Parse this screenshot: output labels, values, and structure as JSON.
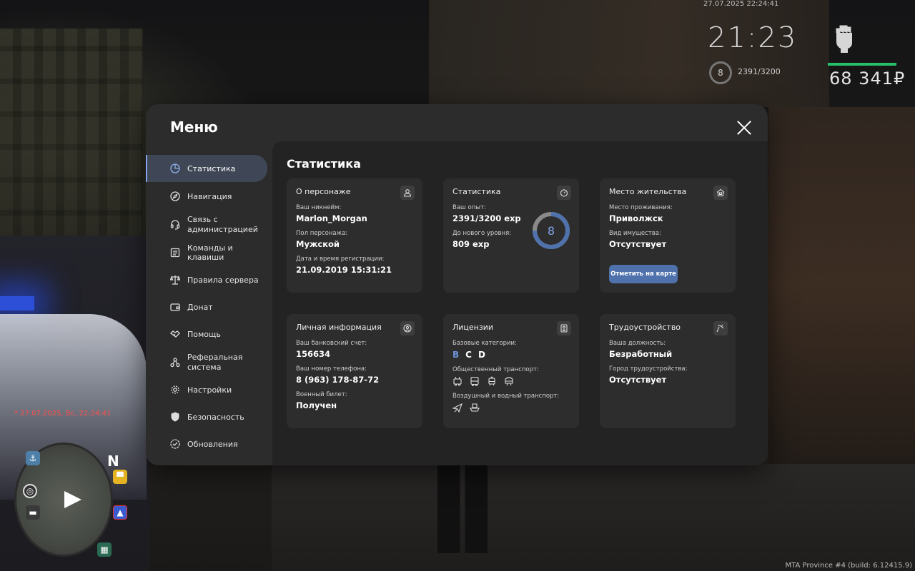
{
  "hud": {
    "datetime": "27.07.2025 22:24:41",
    "clock": "21:23",
    "level": "8",
    "exp": "2391/3200",
    "money": "68 341₽",
    "chat_message": "* 27.07.2025, Вс, 22:24:41",
    "build": "MTA Province #4 (build: 6.12415.9)",
    "minimap_north": "N"
  },
  "menu": {
    "title": "Меню",
    "sidebar": [
      {
        "label": "Статистика",
        "icon": "pie-chart-icon",
        "active": true
      },
      {
        "label": "Навигация",
        "icon": "compass-icon"
      },
      {
        "label": "Связь с администрацией",
        "icon": "headset-icon"
      },
      {
        "label": "Команды и клавиши",
        "icon": "list-icon"
      },
      {
        "label": "Правила сервера",
        "icon": "scales-icon"
      },
      {
        "label": "Донат",
        "icon": "wallet-icon"
      },
      {
        "label": "Помощь",
        "icon": "handshake-icon"
      },
      {
        "label": "Реферальная система",
        "icon": "people-icon"
      },
      {
        "label": "Настройки",
        "icon": "gear-icon"
      },
      {
        "label": "Безопасность",
        "icon": "shield-icon"
      },
      {
        "label": "Обновления",
        "icon": "check-circle-icon"
      }
    ],
    "content_title": "Статистика",
    "cards": {
      "character": {
        "title": "О персонаже",
        "nickname_label": "Ваш никнейм:",
        "nickname": "Marlon_Morgan",
        "gender_label": "Пол персонажа:",
        "gender": "Мужской",
        "reg_label": "Дата и время регистрации:",
        "reg_date": "21.09.2019 15:31:21"
      },
      "stats": {
        "title": "Статистика",
        "exp_label": "Ваш опыт:",
        "exp": "2391/3200 exp",
        "next_label": "До нового уровня:",
        "next": "809 exp",
        "level": "8",
        "progress": 0.747,
        "accent": "#7fa3e6"
      },
      "residence": {
        "title": "Место жительства",
        "place_label": "Место проживания:",
        "place": "Приволжск",
        "property_label": "Вид имущества:",
        "property": "Отсутствует",
        "button": "Отметить на карте"
      },
      "personal": {
        "title": "Личная информация",
        "bank_label": "Ваш банковский счет:",
        "bank": "156634",
        "phone_label": "Ваш номер телефона:",
        "phone": "8 (963) 178-87-72",
        "military_label": "Военный билет:",
        "military": "Получен"
      },
      "licenses": {
        "title": "Лицензии",
        "basic_label": "Базовые категории:",
        "categories": [
          {
            "name": "B",
            "active": true
          },
          {
            "name": "C",
            "active": false
          },
          {
            "name": "D",
            "active": false
          }
        ],
        "public_label": "Общественный транспорт:",
        "air_label": "Воздушный и водный транспорт:"
      },
      "employment": {
        "title": "Трудоустройство",
        "position_label": "Ваша должность:",
        "position": "Безработный",
        "city_label": "Город трудоустройства:",
        "city": "Отсутствует"
      }
    }
  }
}
